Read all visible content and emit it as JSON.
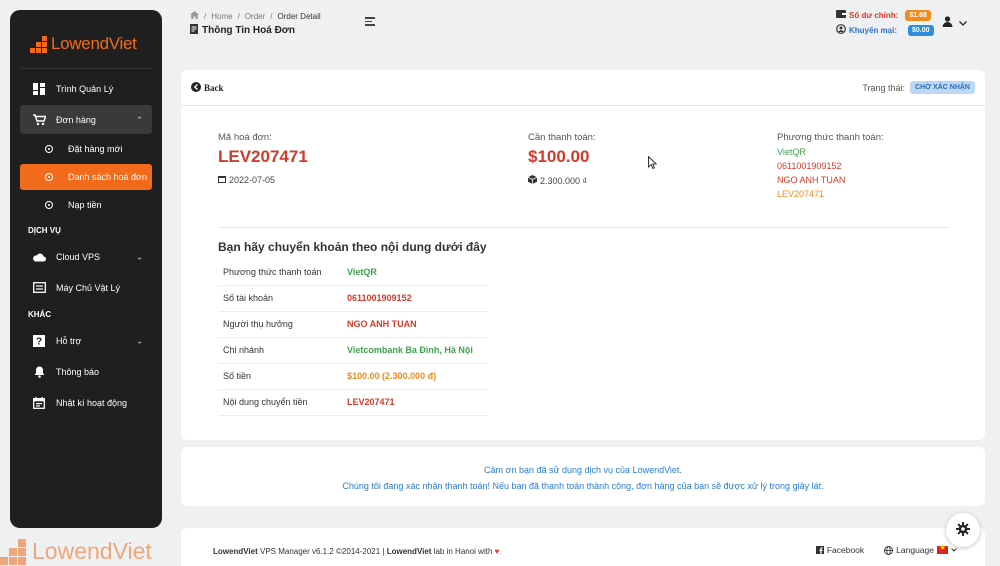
{
  "brand": {
    "name": "LowendViet",
    "accent": "#f26b1d"
  },
  "sidebar": {
    "items": [
      {
        "label": "Trình Quản Lý",
        "icon": "dashboard-icon"
      },
      {
        "label": "Đơn hàng",
        "icon": "cart-icon"
      },
      {
        "label": "Đặt hàng mới",
        "icon": "circle-dot-icon"
      },
      {
        "label": "Danh sách hoá đơn",
        "icon": "circle-dot-icon"
      },
      {
        "label": "Nạp tiền",
        "icon": "circle-dot-icon"
      },
      {
        "label": "Cloud VPS",
        "icon": "cloud-icon"
      },
      {
        "label": "Máy Chủ Vật Lý",
        "icon": "server-icon"
      },
      {
        "label": "Hỗ trợ",
        "icon": "help-icon"
      },
      {
        "label": "Thông báo",
        "icon": "bell-icon"
      },
      {
        "label": "Nhật kí hoạt động",
        "icon": "calendar-icon"
      }
    ],
    "sections": {
      "services": "DỊCH VỤ",
      "other": "KHÁC"
    }
  },
  "header": {
    "breadcrumb": [
      "Home",
      "Order",
      "Order Detail"
    ],
    "title": "Thông Tin Hoá Đơn",
    "balance_label": "Số dư chính:",
    "balance_value": "$1.68",
    "promo_label": "Khuyến mại:",
    "promo_value": "$0.00"
  },
  "invoice": {
    "back_label": "Back",
    "status_label": "Trạng thái:",
    "status_value": "CHỜ XÁC NHẬN",
    "code_label": "Mã hoá đơn:",
    "code": "LEV207471",
    "date": "2022-07-05",
    "amount_label": "Cần thanh toán:",
    "amount": "$100.00",
    "amount_vnd": "2.300.000 ₫",
    "method_label": "Phương thức thanh toán:",
    "method_lines": [
      "VietQR",
      "0611001909152",
      "NGO ANH TUAN",
      "LEV207471"
    ]
  },
  "instructions": {
    "title": "Bạn hãy chuyển khoản theo nội dung dưới đây",
    "rows": [
      {
        "key": "Phương thức thanh toán",
        "value": "VietQR"
      },
      {
        "key": "Số tài khoản",
        "value": "0611001909152"
      },
      {
        "key": "Người thụ hưởng",
        "value": "NGO ANH TUAN"
      },
      {
        "key": "Chi nhánh",
        "value": "Vietcombank Ba Đình, Hà Nội"
      },
      {
        "key": "Số tiền",
        "value": "$100.00 (2.300.000 đ)"
      },
      {
        "key": "Nội dung chuyển tiền",
        "value": "LEV207471"
      }
    ]
  },
  "thanks": {
    "line1": "Cảm ơn bạn đã sử dụng dịch vụ của LowendViet.",
    "line2": "Chúng tôi đang xác nhận thanh toán! Nếu bạn đã thanh toán thành công, đơn hàng của bạn sẽ được xử lý trong giây lát."
  },
  "footer": {
    "brand": "LowendViet",
    "version_text": "VPS Manager v6.1.2 ©2014-2021 |",
    "lab_text": "lab in Hanoi with",
    "heart": "♥.",
    "facebook": "Facebook",
    "language": "Language"
  }
}
